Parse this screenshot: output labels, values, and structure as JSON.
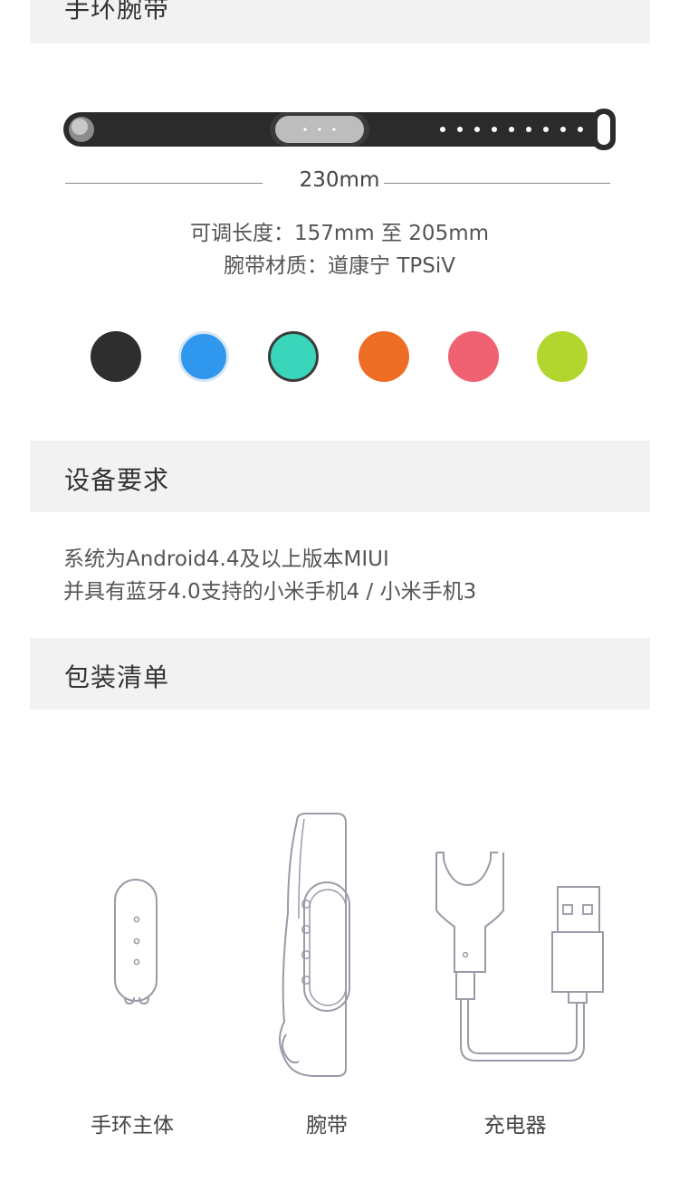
{
  "sections": {
    "band": {
      "title": "手环腕带"
    },
    "requirements": {
      "title": "设备要求"
    },
    "package": {
      "title": "包装清单"
    }
  },
  "band": {
    "length": "230mm",
    "adjustable": "可调长度：157mm 至 205mm",
    "material": "腕带材质：道康宁 TPSiV"
  },
  "colors": [
    {
      "name": "black",
      "hex": "#2e2e2e"
    },
    {
      "name": "blue",
      "hex": "#2f97ee"
    },
    {
      "name": "teal",
      "hex": "#3ad6bc"
    },
    {
      "name": "orange",
      "hex": "#ee6e25"
    },
    {
      "name": "pink",
      "hex": "#f06272"
    },
    {
      "name": "lime",
      "hex": "#b2d62e"
    }
  ],
  "requirements": {
    "line1": "系统为Android4.4及以上版本MIUI",
    "line2": "并具有蓝牙4.0支持的小米手机4 / 小米手机3"
  },
  "package": {
    "items": [
      {
        "label": "手环主体",
        "icon": "tracker-body-icon"
      },
      {
        "label": "腕带",
        "icon": "wristband-icon"
      },
      {
        "label": "充电器",
        "icon": "charger-icon"
      }
    ]
  }
}
